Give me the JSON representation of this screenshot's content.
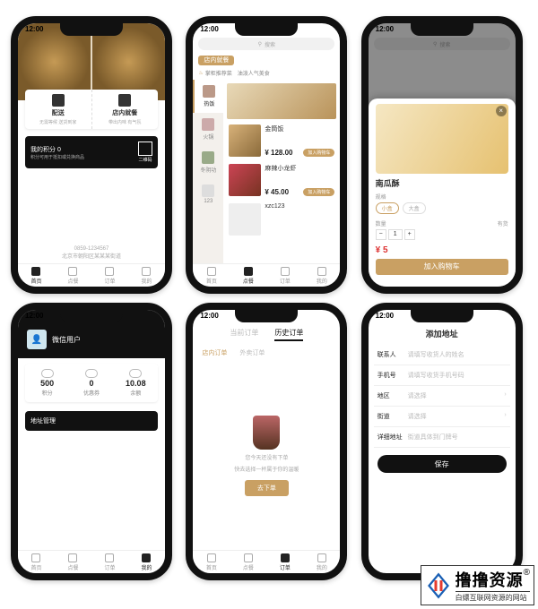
{
  "status_time": "12:00",
  "colors": {
    "accent": "#c9a063"
  },
  "tabbar": [
    "首页",
    "点餐",
    "订单",
    "我的"
  ],
  "phone1": {
    "delivery": {
      "title": "配送",
      "sub": "无需等候 送货到家"
    },
    "dinein": {
      "title": "店内就餐",
      "sub": "带出内味 有气氛"
    },
    "points": {
      "title": "我的积分 0",
      "sub": "积分可用于抵扣或兑换商品"
    },
    "qr": "二维码",
    "phone": "0859-1234567",
    "addr": "北京市朝阳区某某某街道"
  },
  "phone2": {
    "search": "搜索",
    "tab": "店内就餐",
    "subtabs": [
      "掌柜推荐菜",
      "油泼人气美食"
    ],
    "cats": [
      "热饭",
      "火锅",
      "冬阴功",
      "123"
    ],
    "items": [
      {
        "name": "金筒饭",
        "price": "¥ 128.00",
        "btn": "加入购物车"
      },
      {
        "name": "麻辣小龙虾",
        "price": "¥ 45.00",
        "btn": "加入购物车"
      },
      {
        "name": "xzc123",
        "price": "",
        "btn": ""
      }
    ]
  },
  "phone3": {
    "search": "搜索",
    "product": {
      "name": "南瓜酥",
      "spec_label": "规格",
      "specs": [
        "小盒",
        "大盒"
      ],
      "qty_label": "数量",
      "stock": "有货",
      "price": "¥ 5",
      "cart": "加入购物车"
    }
  },
  "phone4": {
    "user": "微信用户",
    "stats": [
      {
        "n": "500",
        "l": "积分"
      },
      {
        "n": "0",
        "l": "优惠券"
      },
      {
        "n": "10.08",
        "l": "余额"
      }
    ],
    "section": "地址管理"
  },
  "phone5": {
    "tabs": [
      "当前订单",
      "历史订单"
    ],
    "subtabs": [
      "店内订单",
      "外卖订单"
    ],
    "empty1": "您今天还没有下单",
    "empty2": "快去选择一杯属于你的温暖",
    "btn": "去下单"
  },
  "phone6": {
    "title": "添加地址",
    "rows": [
      {
        "lab": "联系人",
        "ph": "请填写收货人的姓名"
      },
      {
        "lab": "手机号",
        "ph": "请填写收货手机号码"
      },
      {
        "lab": "地区",
        "ph": "请选择",
        "arrow": true
      },
      {
        "lab": "街道",
        "ph": "请选择",
        "arrow": true
      },
      {
        "lab": "详细地址",
        "ph": "街道具体到门牌号"
      }
    ],
    "save": "保存"
  },
  "watermark": {
    "brand": "撸撸资源",
    "reg": "®",
    "sub": "白嫖互联网资源的网站"
  }
}
